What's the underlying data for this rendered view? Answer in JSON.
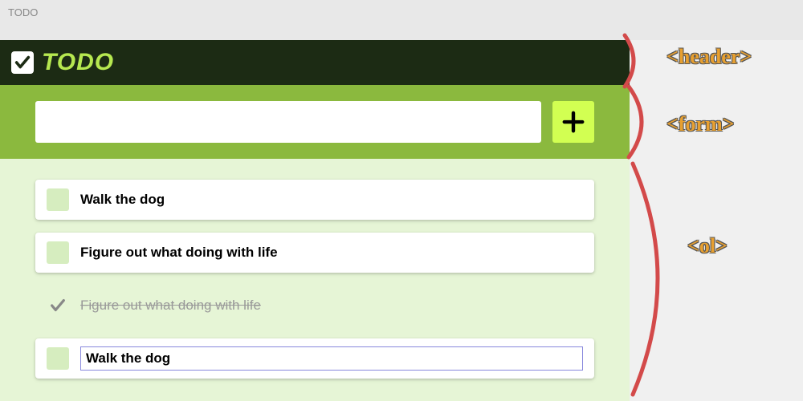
{
  "browser": {
    "tab_label": "TODO"
  },
  "header": {
    "title": "TODO",
    "logo_icon": "check-icon"
  },
  "form": {
    "input_value": "",
    "input_placeholder": "",
    "add_button_icon": "plus-icon"
  },
  "todos": [
    {
      "label": "Walk the dog",
      "completed": false,
      "editing": false
    },
    {
      "label": "Figure out what doing with life",
      "completed": false,
      "editing": false
    },
    {
      "label": "Figure out what doing with life",
      "completed": true,
      "editing": false
    },
    {
      "label": "Walk the dog",
      "completed": false,
      "editing": true
    }
  ],
  "annotations": {
    "header": "<header>",
    "form": "<form>",
    "ol": "<ol>"
  },
  "colors": {
    "header_bg": "#1c2b14",
    "accent_green": "#b6e850",
    "form_bg": "#8bb93e",
    "add_button_bg": "#d2ff52",
    "page_bg": "#e6f5d6",
    "annotation_text": "#e8a030",
    "bracket_stroke": "#d34a4a"
  }
}
